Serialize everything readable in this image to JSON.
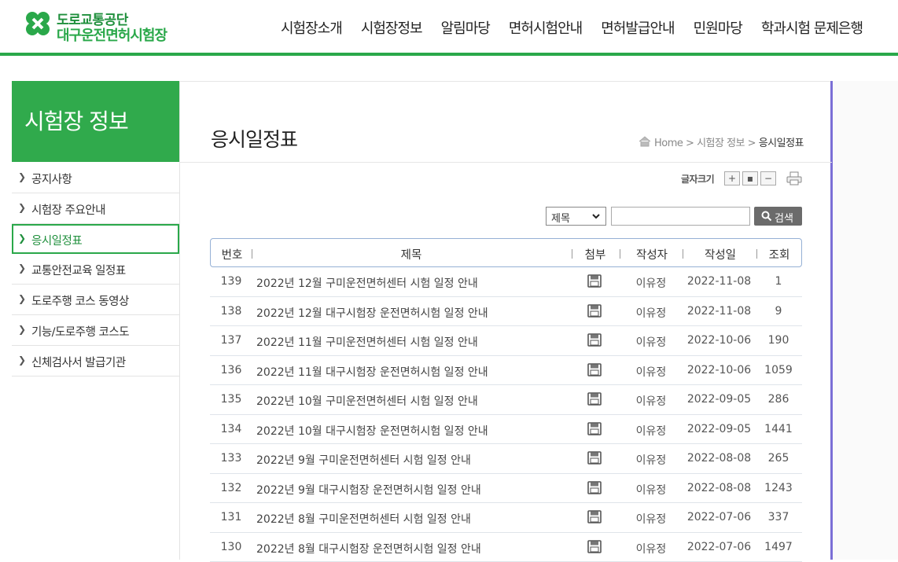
{
  "header": {
    "logo_line1": "도로교통공단",
    "logo_line2": "대구운전면허시험장",
    "nav": [
      "시험장소개",
      "시험장정보",
      "알림마당",
      "면허시험안내",
      "면허발급안내",
      "민원마당",
      "학과시험 문제은행"
    ]
  },
  "sidebar": {
    "title": "시험장 정보",
    "items": [
      {
        "label": "공지사항"
      },
      {
        "label": "시험장 주요안내"
      },
      {
        "label": "응시일정표",
        "active": true
      },
      {
        "label": "교통안전교육 일정표"
      },
      {
        "label": "도로주행 코스 동영상"
      },
      {
        "label": "기능/도로주행 코스도"
      },
      {
        "label": "신체검사서 발급기관"
      }
    ]
  },
  "page": {
    "title": "응시일정표",
    "breadcrumb": {
      "home": "Home",
      "sep": ">",
      "section": "시험장 정보",
      "current": "응시일정표"
    }
  },
  "tools": {
    "font_size_label": "글자크기",
    "plus": "+",
    "reset": "▪",
    "minus": "−"
  },
  "search": {
    "select_value": "제목",
    "input_value": "",
    "button_label": "검색"
  },
  "table": {
    "headers": {
      "num": "번호",
      "subject": "제목",
      "file": "첨부",
      "writer": "작성자",
      "date": "작성일",
      "views": "조회"
    },
    "rows": [
      {
        "num": "139",
        "subject": "2022년 12월 구미운전면허센터 시험 일정 안내",
        "writer": "이유정",
        "date": "2022-11-08",
        "views": "1"
      },
      {
        "num": "138",
        "subject": "2022년 12월 대구시험장 운전면허시험 일정 안내",
        "writer": "이유정",
        "date": "2022-11-08",
        "views": "9"
      },
      {
        "num": "137",
        "subject": "2022년 11월 구미운전면허센터 시험 일정 안내",
        "writer": "이유정",
        "date": "2022-10-06",
        "views": "190"
      },
      {
        "num": "136",
        "subject": "2022년 11월 대구시험장 운전면허시험 일정 안내",
        "writer": "이유정",
        "date": "2022-10-06",
        "views": "1059"
      },
      {
        "num": "135",
        "subject": "2022년 10월 구미운전면허센터 시험 일정 안내",
        "writer": "이유정",
        "date": "2022-09-05",
        "views": "286"
      },
      {
        "num": "134",
        "subject": "2022년 10월 대구시험장 운전면허시험 일정 안내",
        "writer": "이유정",
        "date": "2022-09-05",
        "views": "1441"
      },
      {
        "num": "133",
        "subject": "2022년 9월 구미운전면허센터 시험 일정 안내",
        "writer": "이유정",
        "date": "2022-08-08",
        "views": "265"
      },
      {
        "num": "132",
        "subject": "2022년 9월 대구시험장 운전면허시험 일정 안내",
        "writer": "이유정",
        "date": "2022-08-08",
        "views": "1243"
      },
      {
        "num": "131",
        "subject": "2022년 8월 구미운전면허센터 시험 일정 안내",
        "writer": "이유정",
        "date": "2022-07-06",
        "views": "337"
      },
      {
        "num": "130",
        "subject": "2022년 8월 대구시험장 운전면허시험 일정 안내",
        "writer": "이유정",
        "date": "2022-07-06",
        "views": "1497"
      }
    ]
  },
  "colors": {
    "brand_green": "#2aa84a",
    "table_border": "#95b0d5",
    "accent_purple": "#7b6fd6"
  }
}
